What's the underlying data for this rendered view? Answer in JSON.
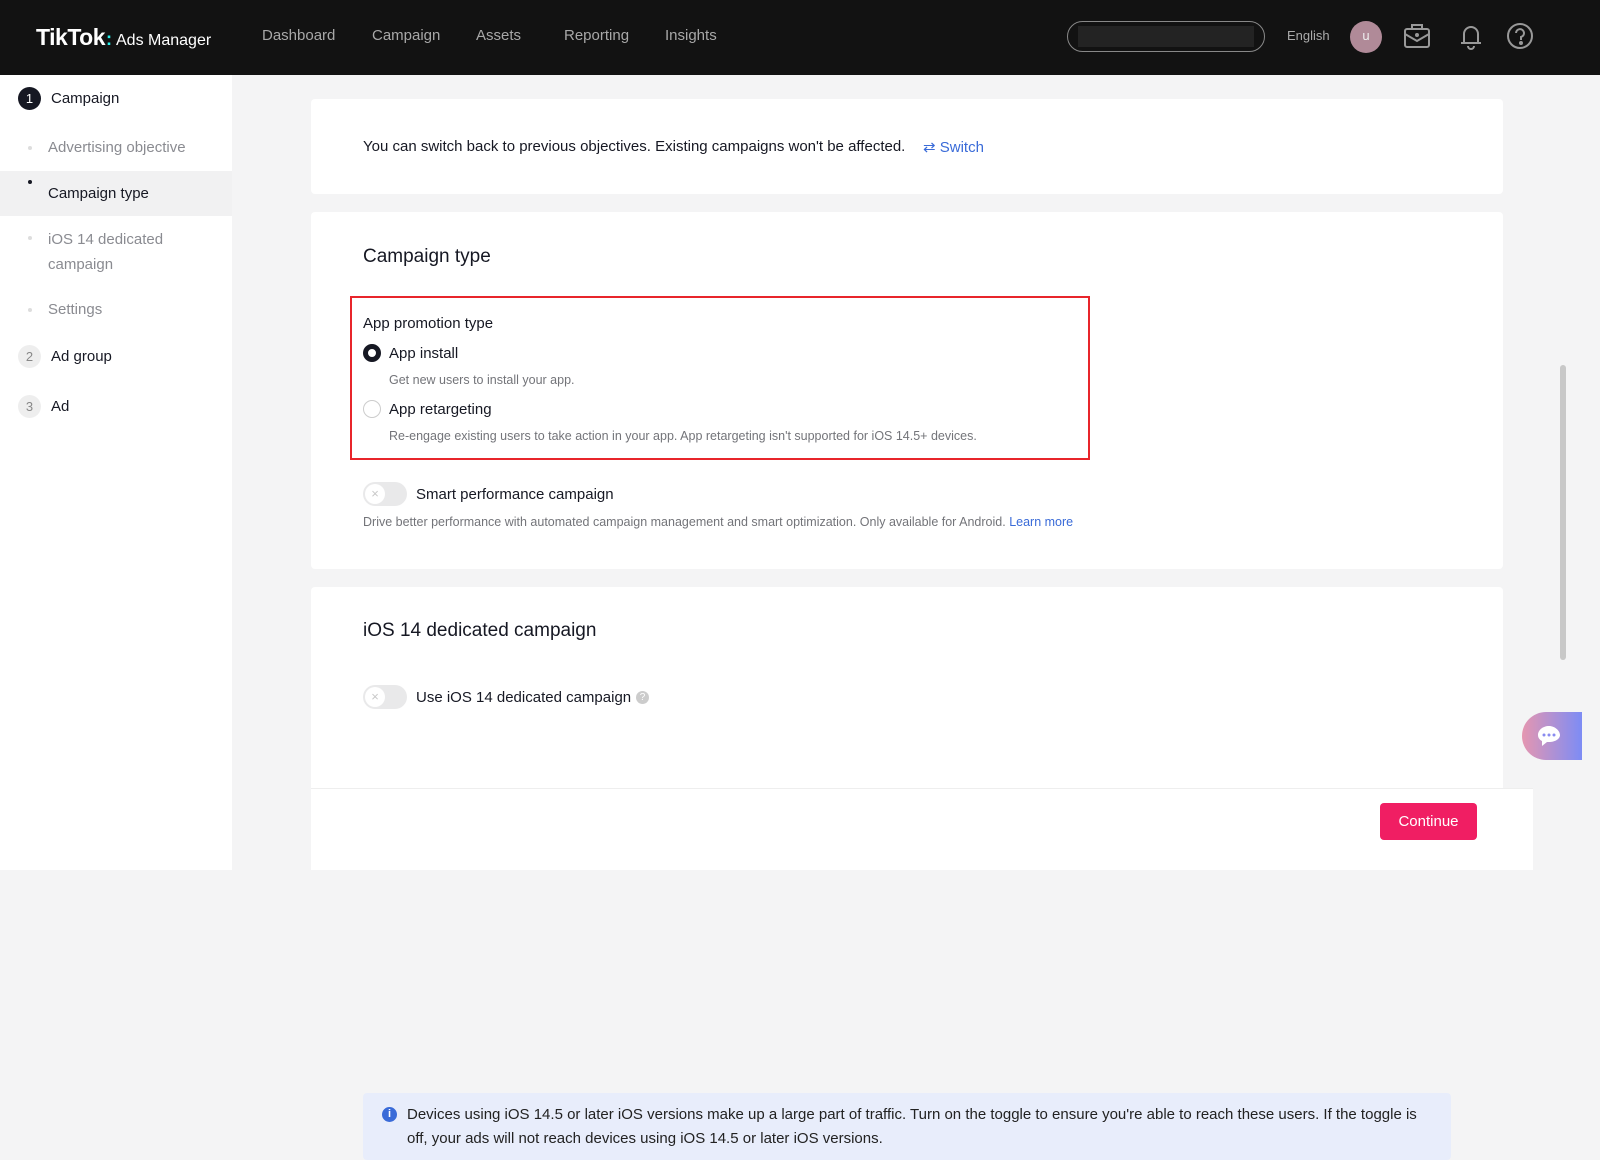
{
  "header": {
    "brand": "TikTok",
    "brand_sub": "Ads Manager",
    "nav": [
      "Dashboard",
      "Campaign",
      "Assets",
      "Reporting",
      "Insights"
    ],
    "language": "English",
    "avatar_initial": "u",
    "icons": [
      "briefcase-icon",
      "bell-icon",
      "help-icon"
    ]
  },
  "sidebar": {
    "steps": [
      {
        "num": "1",
        "label": "Campaign"
      },
      {
        "num": "2",
        "label": "Ad group"
      },
      {
        "num": "3",
        "label": "Ad"
      }
    ],
    "substeps": [
      "Advertising objective",
      "Campaign type",
      "iOS 14 dedicated campaign",
      "Settings"
    ],
    "active_substep": "Campaign type"
  },
  "objective_notice": {
    "text": "You can switch back to previous objectives. Existing campaigns won't be affected.",
    "switch_label": "Switch"
  },
  "campaign_type": {
    "title": "Campaign type",
    "promotion_label": "App promotion type",
    "options": [
      {
        "label": "App install",
        "desc": "Get new users to install your app.",
        "selected": true
      },
      {
        "label": "App retargeting",
        "desc": "Re-engage existing users to take action in your app. App retargeting isn't supported for iOS 14.5+ devices.",
        "selected": false
      }
    ],
    "smart": {
      "label": "Smart performance campaign",
      "enabled": false,
      "desc": "Drive better performance with automated campaign management and smart optimization. Only available for Android.",
      "link": "Learn more"
    }
  },
  "ios14": {
    "title": "iOS 14 dedicated campaign",
    "toggle_label": "Use iOS 14 dedicated campaign",
    "enabled": false,
    "info": "Devices using iOS 14.5 or later iOS versions make up a large part of traffic. Turn on the toggle to ensure you're able to reach these users. If the toggle is off, your ads will not reach devices using iOS 14.5 or later iOS versions."
  },
  "footer": {
    "continue_label": "Continue"
  },
  "colors": {
    "primary": "#f01e63",
    "link": "#3a6bd8",
    "highlight": "#e8252b"
  }
}
